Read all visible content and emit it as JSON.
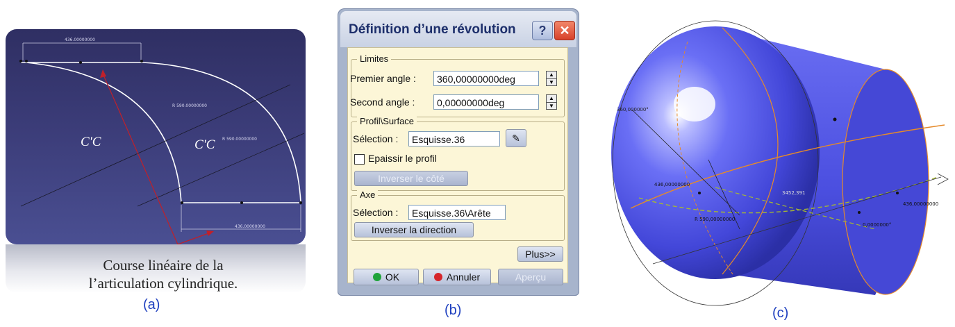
{
  "panel_a": {
    "label": "(a)",
    "dim_top": "436.00000000",
    "dim_bottom": "436.00000000",
    "radius_1": "R 590.00000000",
    "radius_2": "R 590.00000000",
    "cc_left": "C'C",
    "cc_right": "C'C",
    "caption_line1": "Course linéaire de la",
    "caption_line2": "l’articulation cylindrique."
  },
  "dialog": {
    "label": "(b)",
    "title": "Définition d’une révolution",
    "help_label": "?",
    "close_label": "✕",
    "limits": {
      "legend": "Limites",
      "first_angle_label": "Premier angle :",
      "first_angle_value": "360,00000000deg",
      "second_angle_label": "Second angle :",
      "second_angle_value": "0,00000000deg"
    },
    "profile": {
      "legend": "Profil\\Surface",
      "selection_label": "Sélection :",
      "selection_value": "Esquisse.36",
      "thicken_label": "Epaissir le profil",
      "reverse_side_label": "Inverser le côté"
    },
    "axis": {
      "legend": "Axe",
      "selection_label": "Sélection :",
      "selection_value": "Esquisse.36\\Arête",
      "reverse_direction_label": "Inverser la direction"
    },
    "more_label": "Plus>>",
    "ok_label": "OK",
    "cancel_label": "Annuler",
    "preview_label": "Aperçu",
    "colors": {
      "title": "#1d2f6b",
      "body": "#fcf6d7",
      "ok_led": "#1fa33a",
      "cancel_led": "#d6262b"
    }
  },
  "panel_c": {
    "label": "(c)",
    "angle_label": "360,000000°",
    "dim_1": "436,00000000",
    "dim_2": "436,00000000",
    "radius_label": "R 590,00000000",
    "mid_label": "3452,391",
    "small_label": "0,0000000°",
    "colors": {
      "solid": "#4a4ee6",
      "edges": "#e58a2a",
      "guides": "#a6b832"
    }
  }
}
